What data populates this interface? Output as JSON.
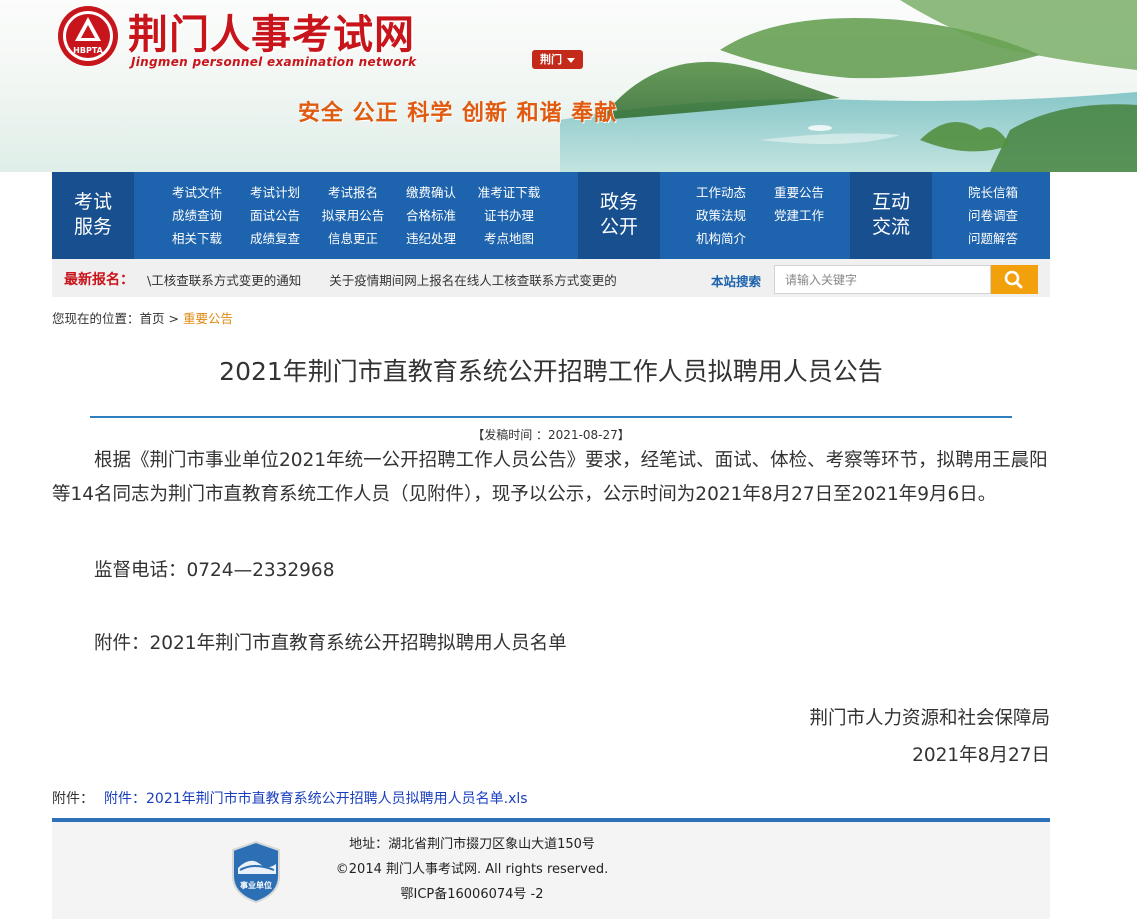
{
  "header": {
    "site_title": "荆门人事考试网",
    "site_subtitle": "Jingmen personnel examination network",
    "logo_text": "HBPTA",
    "city_selector": "荆门",
    "slogan": "安全 公正 科学 创新 和谐 奉献"
  },
  "nav": {
    "groups": [
      {
        "title_line1": "考试",
        "title_line2": "服务",
        "items": [
          "考试文件",
          "考试计划",
          "考试报名",
          "缴费确认",
          "准考证下载",
          "成绩查询",
          "面试公告",
          "拟录用公告",
          "合格标准",
          "证书办理",
          "相关下载",
          "成绩复查",
          "信息更正",
          "违纪处理",
          "考点地图"
        ]
      },
      {
        "title_line1": "政务",
        "title_line2": "公开",
        "items": [
          "工作动态",
          "重要公告",
          "政策法规",
          "党建工作",
          "机构简介"
        ]
      },
      {
        "title_line1": "互动",
        "title_line2": "交流",
        "items": [
          "院长信箱",
          "问卷调查",
          "问题解答"
        ]
      }
    ]
  },
  "latest": {
    "label": "最新报名：",
    "items": [
      "\\工核查联系方式变更的通知",
      "关于疫情期间网上报名在线人工核查联系方式变更的"
    ]
  },
  "search": {
    "label": "本站搜索",
    "placeholder": "请输入关键字"
  },
  "breadcrumb": {
    "prefix": "您现在的位置：",
    "home": "首页",
    "separator": ">",
    "current": "重要公告"
  },
  "article": {
    "title": "2021年荆门市直教育系统公开招聘工作人员拟聘用人员公告",
    "publish_date": "【发稿时间 ：2021-08-27】",
    "paragraph1": "根据《荆门市事业单位2021年统一公开招聘工作人员公告》要求，经笔试、面试、体检、考察等环节，拟聘用王晨阳等14名同志为荆门市直教育系统工作人员（见附件），现予以公示，公示时间为2021年8月27日至2021年9月6日。",
    "supervision_phone": "监督电话：0724—2332968",
    "attachment_line": "附件：2021年荆门市直教育系统公开招聘拟聘用人员名单",
    "signature": "荆门市人力资源和社会保障局",
    "signature_date": "2021年8月27日"
  },
  "attachment": {
    "label": "附件：",
    "link_text": "附件：2021年荆门市市直教育系统公开招聘人员拟聘用人员名单.xls"
  },
  "footer": {
    "badge_text": "事业单位",
    "address": "地址：湖北省荆门市掇刀区象山大道150号",
    "copyright": "©2014 荆门人事考试网. All rights reserved.",
    "icp": "鄂ICP备16006074号 -2"
  },
  "colors": {
    "brand_red": "#c8141b",
    "nav_blue": "#1e63ad",
    "nav_dark_blue": "#174f8f",
    "slogan_orange": "#e05a10",
    "search_button": "#f2a10c",
    "breadcrumb_current": "#e08a12",
    "link_blue": "#1a3fbd"
  },
  "icons": {
    "search_button": "magnifier-icon",
    "city_dropdown": "caret-down-icon",
    "logo": "hbpta-emblem-icon",
    "footer_badge": "public-institution-badge-icon"
  }
}
